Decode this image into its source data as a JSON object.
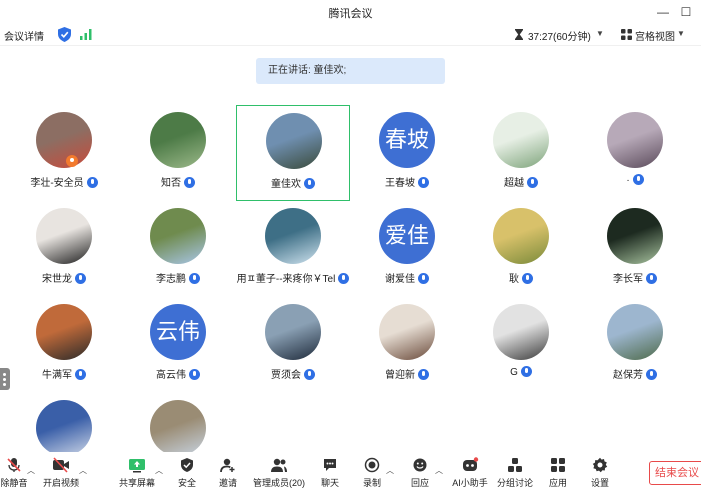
{
  "window": {
    "title": "腾讯会议",
    "minimize": "—",
    "maximize": "☐"
  },
  "topbar": {
    "meeting_info": "会议详情",
    "timer": "37:27(60分钟)",
    "view_mode": "宫格视图"
  },
  "speaking_banner": "正在讲话: 童佳欢;",
  "participants": [
    {
      "name": "李壮-安全员",
      "avatar_type": "photo",
      "avatar_color": "#8c6e63",
      "avatar_accent": "#c94a3a",
      "host": true
    },
    {
      "name": "知否",
      "avatar_type": "photo",
      "avatar_color": "#4d7b47",
      "avatar_accent": "#9cb98a",
      "host": false
    },
    {
      "name": "童佳欢",
      "avatar_type": "photo",
      "avatar_color": "#6f8fb0",
      "avatar_accent": "#3a4a3a",
      "host": false,
      "active": true
    },
    {
      "name": "王春坡",
      "avatar_type": "text",
      "avatar_text": "春坡",
      "host": false
    },
    {
      "name": "超越",
      "avatar_type": "photo",
      "avatar_color": "#e7efe5",
      "avatar_accent": "#7da37a",
      "host": false
    },
    {
      "name": "·",
      "avatar_type": "photo",
      "avatar_color": "#b7a9b8",
      "avatar_accent": "#5a4a5a",
      "host": false
    },
    {
      "name": "宋世龙",
      "avatar_type": "photo",
      "avatar_color": "#e8e4e0",
      "avatar_accent": "#1e1e1e",
      "host": false
    },
    {
      "name": "李志鹏",
      "avatar_type": "photo",
      "avatar_color": "#6f8b4e",
      "avatar_accent": "#a9c6e8",
      "host": false
    },
    {
      "name": "用ㅍ董子--来疼你￥Tel",
      "avatar_type": "photo",
      "avatar_color": "#3e6f86",
      "avatar_accent": "#cfe3ef",
      "host": false
    },
    {
      "name": "谢爱佳",
      "avatar_type": "text",
      "avatar_text": "爱佳",
      "host": false
    },
    {
      "name": "耿",
      "avatar_type": "photo",
      "avatar_color": "#d8c16a",
      "avatar_accent": "#7a8a3a",
      "host": false
    },
    {
      "name": "李长军",
      "avatar_type": "photo",
      "avatar_color": "#1d2a20",
      "avatar_accent": "#a9c4a0",
      "host": false
    },
    {
      "name": "牛满军",
      "avatar_type": "photo",
      "avatar_color": "#c06a3a",
      "avatar_accent": "#2a2a2a",
      "host": false
    },
    {
      "name": "高云伟",
      "avatar_type": "text",
      "avatar_text": "云伟",
      "host": false
    },
    {
      "name": "贾须会",
      "avatar_type": "photo",
      "avatar_color": "#8aa0b4",
      "avatar_accent": "#1e2a3a",
      "host": false
    },
    {
      "name": "曾迎新",
      "avatar_type": "photo",
      "avatar_color": "#e6ddd3",
      "avatar_accent": "#6a4a3a",
      "host": false
    },
    {
      "name": "G",
      "avatar_type": "photo",
      "avatar_color": "#e2e2e2",
      "avatar_accent": "#3a3a3a",
      "host": false
    },
    {
      "name": "赵保芳",
      "avatar_type": "photo",
      "avatar_color": "#9db6cf",
      "avatar_accent": "#4e6a4a",
      "host": false
    },
    {
      "name": "",
      "avatar_type": "photo",
      "avatar_color": "#3a5fa8",
      "avatar_accent": "#cfd8e8",
      "host": false
    },
    {
      "name": "",
      "avatar_type": "photo",
      "avatar_color": "#9a8c74",
      "avatar_accent": "#c8d4e2",
      "host": false
    }
  ],
  "toolbar": {
    "unmute": "除静音",
    "start_video": "开启视频",
    "share_screen": "共享屏幕",
    "security": "安全",
    "invite": "邀请",
    "manage_members": "管理成员(20)",
    "chat": "聊天",
    "record": "录制",
    "reaction": "回应",
    "ai_assistant": "AI小助手",
    "breakout": "分组讨论",
    "apps": "应用",
    "settings": "设置",
    "end_meeting": "结束会议"
  },
  "colors": {
    "accent": "#2f6fe4",
    "active_border": "#2fbf6a",
    "end_red": "#e84a4a",
    "banner_bg": "#dbe9fb",
    "text_avatar": "#3e6fd3"
  }
}
